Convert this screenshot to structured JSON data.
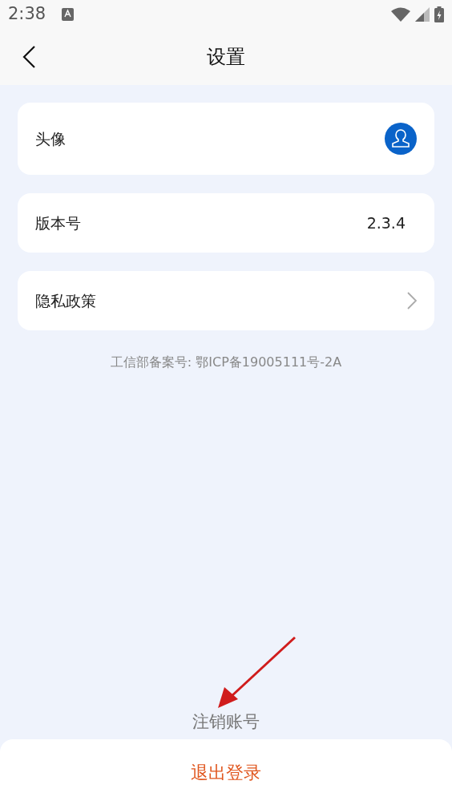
{
  "status_bar": {
    "time": "2:38"
  },
  "header": {
    "title": "设置"
  },
  "rows": [
    {
      "kind": "avatar",
      "label": "头像"
    },
    {
      "kind": "value",
      "label": "版本号",
      "value": "2.3.4"
    },
    {
      "kind": "link",
      "label": "隐私政策"
    }
  ],
  "icp": "工信部备案号: 鄂ICP备19005111号-2A",
  "delete_account": "注销账号",
  "logout": "退出登录"
}
